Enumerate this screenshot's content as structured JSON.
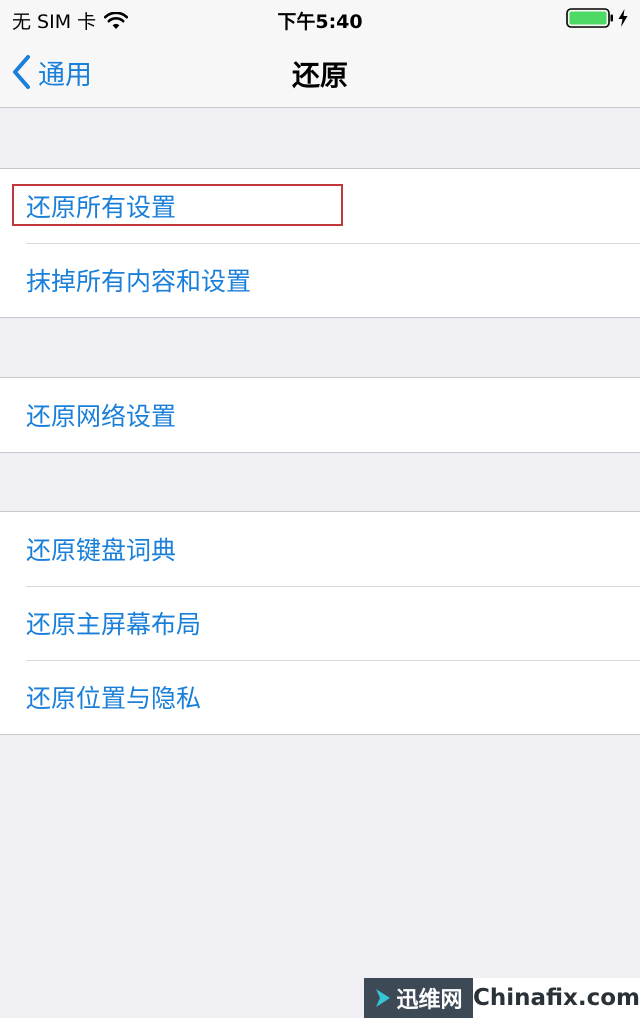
{
  "status_bar": {
    "carrier": "无 SIM 卡",
    "time": "下午5:40",
    "battery": "full-charging"
  },
  "nav": {
    "back_label": "通用",
    "title": "还原"
  },
  "groups": [
    {
      "items": [
        "还原所有设置",
        "抹掉所有内容和设置"
      ]
    },
    {
      "items": [
        "还原网络设置"
      ]
    },
    {
      "items": [
        "还原键盘词典",
        "还原主屏幕布局",
        "还原位置与隐私"
      ]
    }
  ],
  "highlighted_item": "还原所有设置",
  "watermark": {
    "left": "迅维网",
    "right": "Chinafix.com"
  },
  "colors": {
    "accent": "#1a7fd9",
    "background": "#efeff4",
    "highlight": "#c0383c",
    "battery": "#4cd964"
  },
  "icons": [
    "wifi-icon",
    "battery-icon",
    "bolt-icon",
    "chevron-left-icon",
    "watermark-logo-icon"
  ]
}
